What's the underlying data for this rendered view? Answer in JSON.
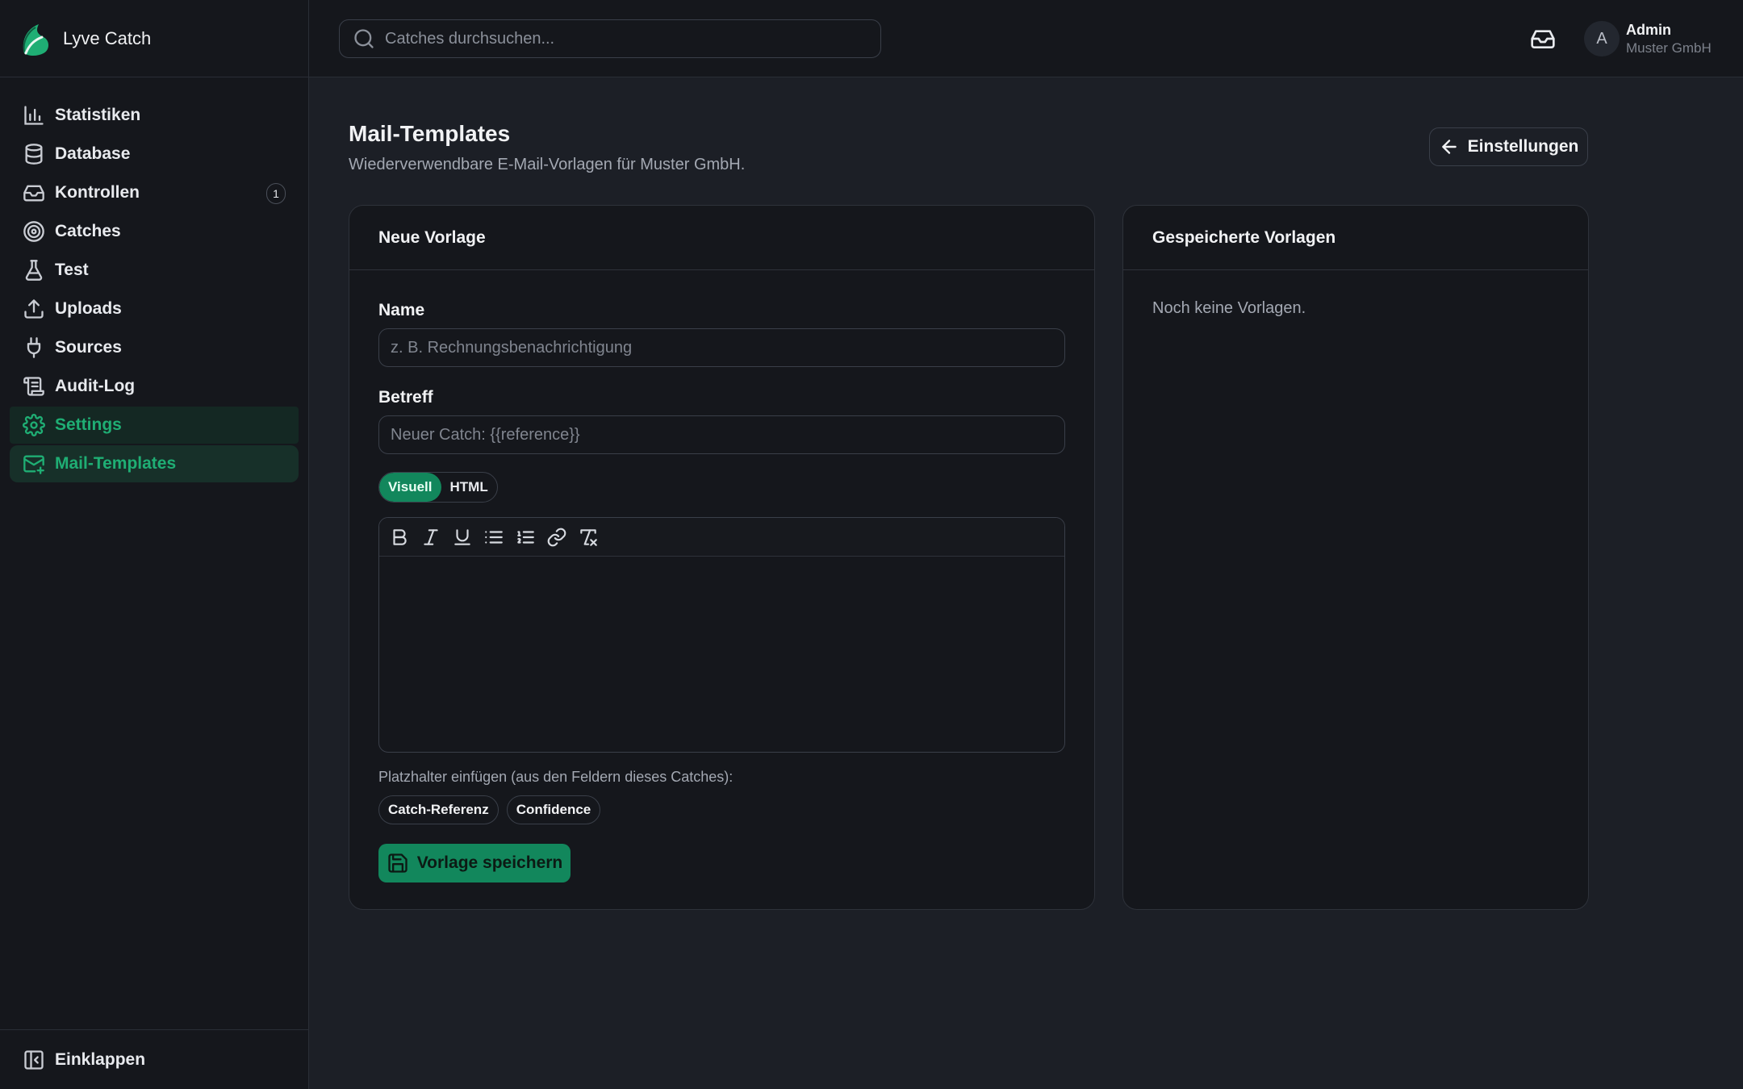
{
  "app": {
    "name": "Lyve Catch"
  },
  "sidebar": {
    "items": [
      {
        "label": "Statistiken",
        "icon": "bar-chart-icon"
      },
      {
        "label": "Database",
        "icon": "database-icon"
      },
      {
        "label": "Kontrollen",
        "icon": "inbox-icon",
        "badge": "1"
      },
      {
        "label": "Catches",
        "icon": "target-icon"
      },
      {
        "label": "Test",
        "icon": "flask-icon"
      },
      {
        "label": "Uploads",
        "icon": "upload-icon"
      },
      {
        "label": "Sources",
        "icon": "plug-icon"
      },
      {
        "label": "Audit-Log",
        "icon": "scroll-icon"
      },
      {
        "label": "Settings",
        "icon": "gear-icon"
      },
      {
        "label": "Mail-Templates",
        "icon": "mail-plus-icon"
      }
    ],
    "collapse_label": "Einklappen"
  },
  "topbar": {
    "search_placeholder": "Catches durchsuchen...",
    "user": {
      "initial": "A",
      "name": "Admin",
      "org": "Muster GmbH"
    }
  },
  "page": {
    "title": "Mail-Templates",
    "subtitle": "Wiederverwendbare E-Mail-Vorlagen für Muster GmbH.",
    "back_label": "Einstellungen"
  },
  "new_template": {
    "header": "Neue Vorlage",
    "name_label": "Name",
    "name_placeholder": "z. B. Rechnungsbenachrichtigung",
    "subject_label": "Betreff",
    "subject_placeholder": "Neuer Catch: {{reference}}",
    "mode_visual": "Visuell",
    "mode_html": "HTML",
    "toolbar": [
      "bold-icon",
      "italic-icon",
      "underline-icon",
      "bullet-list-icon",
      "numbered-list-icon",
      "link-icon",
      "clear-format-icon"
    ],
    "placeholder_hint": "Platzhalter einfügen (aus den Feldern dieses Catches):",
    "chips": [
      "Catch-Referenz",
      "Confidence"
    ],
    "save_label": "Vorlage speichern"
  },
  "saved_templates": {
    "header": "Gespeicherte Vorlagen",
    "empty_text": "Noch keine Vorlagen."
  },
  "colors": {
    "accent": "#12875c",
    "accent_text": "#1fae74",
    "background": "#1c1f26",
    "panel": "#15171c"
  }
}
